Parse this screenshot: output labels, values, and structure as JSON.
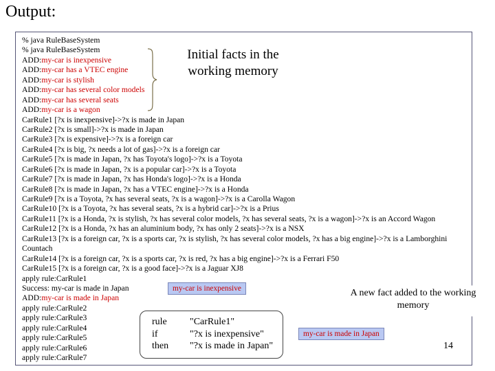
{
  "heading": "Output:",
  "log_lines": [
    [
      {
        "t": "% java RuleBaseSystem",
        "red": false
      }
    ],
    [
      {
        "t": "% java RuleBaseSystem",
        "red": false
      }
    ],
    [
      {
        "t": "ADD:",
        "red": false
      },
      {
        "t": "my-car is inexpensive",
        "red": true
      }
    ],
    [
      {
        "t": "ADD:",
        "red": false
      },
      {
        "t": "my-car has a VTEC engine",
        "red": true
      }
    ],
    [
      {
        "t": "ADD:",
        "red": false
      },
      {
        "t": "my-car is stylish",
        "red": true
      }
    ],
    [
      {
        "t": "ADD:",
        "red": false
      },
      {
        "t": "my-car has several color models",
        "red": true
      }
    ],
    [
      {
        "t": "ADD:",
        "red": false
      },
      {
        "t": "my-car has several seats",
        "red": true
      }
    ],
    [
      {
        "t": "ADD:",
        "red": false
      },
      {
        "t": "my-car is a wagon",
        "red": true
      }
    ],
    [
      {
        "t": "CarRule1 [?x is inexpensive]->?x is made in Japan",
        "red": false
      }
    ],
    [
      {
        "t": "CarRule2 [?x is small]->?x is made in Japan",
        "red": false
      }
    ],
    [
      {
        "t": "CarRule3 [?x is expensive]->?x is a foreign car",
        "red": false
      }
    ],
    [
      {
        "t": "CarRule4 [?x is big, ?x needs a lot of gas]->?x is a foreign car",
        "red": false
      }
    ],
    [
      {
        "t": "CarRule5 [?x is made in Japan, ?x has Toyota's logo]->?x is a Toyota",
        "red": false
      }
    ],
    [
      {
        "t": "CarRule6 [?x is made in Japan, ?x is a popular car]->?x is a Toyota",
        "red": false
      }
    ],
    [
      {
        "t": "CarRule7 [?x is made in Japan, ?x has Honda's logo]->?x is a Honda",
        "red": false
      }
    ],
    [
      {
        "t": "CarRule8 [?x is made in Japan, ?x has a VTEC engine]->?x is a Honda",
        "red": false
      }
    ],
    [
      {
        "t": "CarRule9 [?x is a Toyota, ?x has several seats, ?x is a wagon]->?x is a Carolla Wagon",
        "red": false
      }
    ],
    [
      {
        "t": "CarRule10 [?x is a Toyota, ?x has several seats, ?x is a hybrid car]->?x is a Prius",
        "red": false
      }
    ],
    [
      {
        "t": "CarRule11 [?x is a Honda, ?x is stylish, ?x has several color models, ?x has several seats, ?x is a wagon]->?x is an Accord Wagon",
        "red": false
      }
    ],
    [
      {
        "t": "CarRule12 [?x is a Honda, ?x has an aluminium body, ?x has only 2 seats]->?x is a NSX",
        "red": false
      }
    ],
    [
      {
        "t": "CarRule13 [?x is a foreign car, ?x is a sports car, ?x is stylish, ?x has several color models, ?x has a big engine]->?x is a Lamborghini",
        "red": false
      }
    ],
    [
      {
        "t": "Countach",
        "red": false
      }
    ],
    [
      {
        "t": "CarRule14 [?x is a foreign car, ?x is a sports car, ?x is red, ?x has a big engine]->?x is a Ferrari F50",
        "red": false
      }
    ],
    [
      {
        "t": "CarRule15 [?x is a foreign car, ?x is a good face]->?x is a Jaguar XJ8",
        "red": false
      }
    ],
    [
      {
        "t": "apply rule:CarRule1",
        "red": false
      }
    ],
    [
      {
        "t": "Success: my-car is made in Japan",
        "red": false
      }
    ],
    [
      {
        "t": "ADD:",
        "red": false
      },
      {
        "t": "my-car is made in Japan",
        "red": true
      }
    ],
    [
      {
        "t": "apply rule:CarRule2",
        "red": false
      }
    ],
    [
      {
        "t": "apply rule:CarRule3",
        "red": false
      }
    ],
    [
      {
        "t": "apply rule:CarRule4",
        "red": false
      }
    ],
    [
      {
        "t": "apply rule:CarRule5",
        "red": false
      }
    ],
    [
      {
        "t": "apply rule:CarRule6",
        "red": false
      }
    ],
    [
      {
        "t": "apply rule:CarRule7",
        "red": false
      }
    ]
  ],
  "initial_facts_bubble": "Initial facts in the working memory",
  "matched_fact_label": "my-car is inexpensive",
  "new_fact_bubble": "A new fact added to the working memory",
  "new_fact_label": "my-car is made in Japan",
  "rule_box": {
    "rule_kw": "rule",
    "rule_val": "\"CarRule1\"",
    "if_kw": "if",
    "if_val": "\"?x is inexpensive\"",
    "then_kw": "then",
    "then_val": "\"?x is made in Japan\""
  },
  "page_number": "14",
  "colors": {
    "highlight_text": "#cc0000",
    "callout_fill": "#b9c8f2",
    "frame_border": "#555577"
  }
}
